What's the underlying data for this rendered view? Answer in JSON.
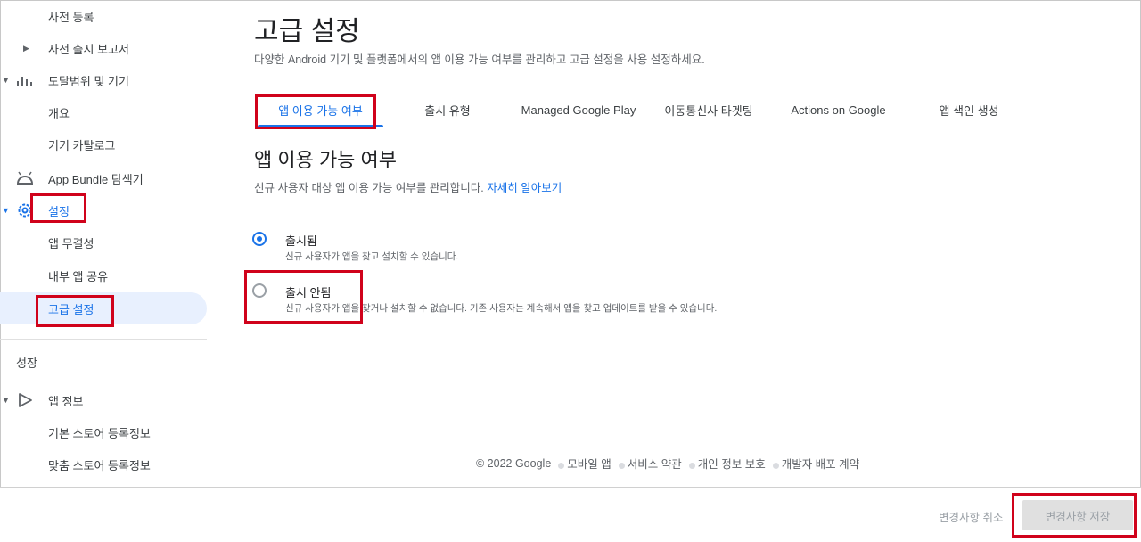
{
  "sidebar": {
    "items": [
      {
        "label": "사전 등록"
      },
      {
        "label": "사전 출시 보고서"
      },
      {
        "label": "도달범위 및 기기"
      },
      {
        "label": "개요"
      },
      {
        "label": "기기 카탈로그"
      },
      {
        "label": "App Bundle 탐색기"
      },
      {
        "label": "설정"
      },
      {
        "label": "앱 무결성"
      },
      {
        "label": "내부 앱 공유"
      },
      {
        "label": "고급 설정"
      }
    ],
    "section_title": "성장",
    "growth_items": [
      {
        "label": "앱 정보"
      },
      {
        "label": "기본 스토어 등록정보"
      },
      {
        "label": "맞춤 스토어 등록정보"
      }
    ]
  },
  "header": {
    "title": "고급 설정",
    "description": "다양한 Android 기기 및 플랫폼에서의 앱 이용 가능 여부를 관리하고 고급 설정을 사용 설정하세요."
  },
  "tabs": [
    {
      "label": "앱 이용 가능 여부",
      "active": true
    },
    {
      "label": "출시 유형"
    },
    {
      "label": "Managed Google Play"
    },
    {
      "label": "이동통신사 타겟팅"
    },
    {
      "label": "Actions on Google"
    },
    {
      "label": "앱 색인 생성"
    }
  ],
  "section": {
    "heading": "앱 이용 가능 여부",
    "subtitle": "신규 사용자 대상 앱 이용 가능 여부를 관리합니다.",
    "learn_more": "자세히 알아보기",
    "options": [
      {
        "title": "출시됨",
        "desc": "신규 사용자가 앱을 찾고 설치할 수 있습니다.",
        "checked": true
      },
      {
        "title": "출시 안됨",
        "desc": "신규 사용자가 앱을 찾거나 설치할 수 없습니다. 기존 사용자는 계속해서 앱을 찾고 업데이트를 받을 수 있습니다.",
        "checked": false
      }
    ]
  },
  "footer": {
    "copyright": "© 2022 Google",
    "links": [
      "모바일 앱",
      "서비스 약관",
      "개인 정보 보호",
      "개발자 배포 계약"
    ]
  },
  "actions": {
    "discard_label": "변경사항 취소",
    "save_label": "변경사항 저장"
  },
  "colors": {
    "accent": "#1a73e8",
    "highlight_box": "#d0021b",
    "active_nav_bg": "#e8f0fe"
  }
}
